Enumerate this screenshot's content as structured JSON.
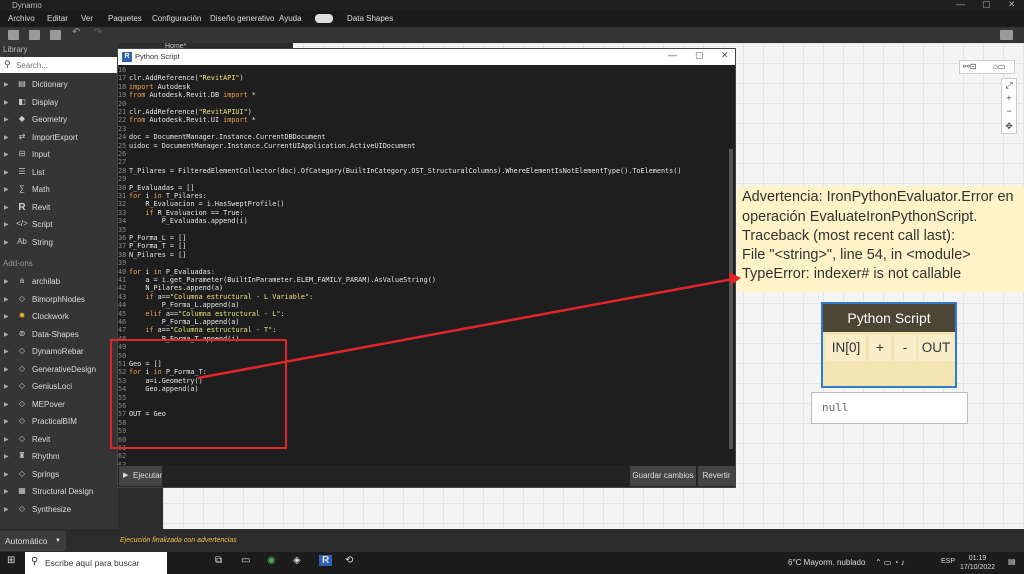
{
  "app": {
    "title": "Dynamo"
  },
  "menu": [
    "Archivo",
    "Editar",
    "Ver",
    "Paquetes",
    "Configuración",
    "Diseño generativo",
    "Ayuda",
    "Data Shapes"
  ],
  "library": {
    "title": "Library",
    "search_placeholder": "Search...",
    "items": [
      "Dictionary",
      "Display",
      "Geometry",
      "ImportExport",
      "Input",
      "List",
      "Math",
      "Revit",
      "Script",
      "String"
    ],
    "addons_label": "Add-ons",
    "addons": [
      "archilab",
      "BimorphNodes",
      "Clockwork",
      "Data-Shapes",
      "DynamoRebar",
      "GenerativeDesign",
      "GeniusLoci",
      "MEPover",
      "PracticalBIM",
      "Revit",
      "Rhythm",
      "Springs",
      "Structural Design",
      "Synthesize"
    ]
  },
  "workspace": {
    "tab": "Home*"
  },
  "editor": {
    "title": "Python Script",
    "run_label": "Ejecutar",
    "save_label": "Guardar cambios",
    "revert_label": "Revertir",
    "lines": [
      [
        "16",
        ""
      ],
      [
        "17",
        "clr.AddReference(\"RevitAPI\")"
      ],
      [
        "18",
        "import Autodesk"
      ],
      [
        "19",
        "from Autodesk.Revit.DB import *"
      ],
      [
        "20",
        ""
      ],
      [
        "21",
        "clr.AddReference(\"RevitAPIUI\")"
      ],
      [
        "22",
        "from Autodesk.Revit.UI import *"
      ],
      [
        "23",
        ""
      ],
      [
        "24",
        "doc = DocumentManager.Instance.CurrentDBDocument"
      ],
      [
        "25",
        "uidoc = DocumentManager.Instance.CurrentUIApplication.ActiveUIDocument"
      ],
      [
        "26",
        ""
      ],
      [
        "27",
        ""
      ],
      [
        "28",
        "T_Pilares = FilteredElementCollector(doc).OfCategory(BuiltInCategory.OST_StructuralColumns).WhereElementIsNotElementType().ToElements()"
      ],
      [
        "29",
        ""
      ],
      [
        "30",
        "P_Evaluadas = []"
      ],
      [
        "31",
        "for i in T_Pilares:"
      ],
      [
        "32",
        "    R_Evaluacion = i.HasSweptProfile()"
      ],
      [
        "33",
        "    if R_Evaluacion == True:"
      ],
      [
        "34",
        "        P_Evaluadas.append(i)"
      ],
      [
        "35",
        ""
      ],
      [
        "36",
        "P_Forma_L = []"
      ],
      [
        "37",
        "P_Forma_T = []"
      ],
      [
        "38",
        "N_Pilares = []"
      ],
      [
        "39",
        ""
      ],
      [
        "40",
        "for i in P_Evaluadas:"
      ],
      [
        "41",
        "    a = i.get_Parameter(BuiltInParameter.ELEM_FAMILY_PARAM).AsValueString()"
      ],
      [
        "42",
        "    N_Pilares.append(a)"
      ],
      [
        "43",
        "    if a==\"Columna estructural - L Variable\":"
      ],
      [
        "44",
        "        P_Forma_L.append(a)"
      ],
      [
        "45",
        "    elif a==\"Columna estructural - L\":"
      ],
      [
        "46",
        "        P_Forma_L.append(a)"
      ],
      [
        "47",
        "    if a==\"Columna estructural - T\":"
      ],
      [
        "48",
        "        P_Forma_T.append(i)"
      ],
      [
        "49",
        ""
      ],
      [
        "50",
        ""
      ],
      [
        "51",
        "Geo = []"
      ],
      [
        "52",
        "for i in P_Forma_T:"
      ],
      [
        "53",
        "    a=i.Geometry()"
      ],
      [
        "54",
        "    Geo.append(a)"
      ],
      [
        "55",
        ""
      ],
      [
        "56",
        ""
      ],
      [
        "57",
        "OUT = Geo"
      ],
      [
        "58",
        ""
      ],
      [
        "59",
        ""
      ],
      [
        "60",
        ""
      ],
      [
        "61",
        ""
      ],
      [
        "62",
        ""
      ],
      [
        "63",
        ""
      ]
    ]
  },
  "warning": {
    "lines": [
      "Advertencia: IronPythonEvaluator.Error en",
      "operación EvaluateIronPythonScript.",
      "Traceback (most recent call last):",
      "  File \"<string>\", line 54, in <module>",
      "TypeError: indexer# is not callable"
    ]
  },
  "node": {
    "title": "Python Script",
    "input_port": "IN[0]",
    "add_port": "+",
    "remove_port": "-",
    "output_port": "OUT",
    "preview_value": "null"
  },
  "status": {
    "run_mode": "Automático",
    "message": "Ejecución finalizada con advertencias"
  },
  "taskbar": {
    "search_placeholder": "Escribe aquí para buscar",
    "weather": "6°C  Mayorm. nublado",
    "language": "ESP",
    "time": "01:19",
    "date": "17/10/2022"
  },
  "colors": {
    "highlight": "#e0262a",
    "node_border": "#2e7bd6",
    "warning_bg": "#fff3c7",
    "status_warning": "#f2c14e"
  }
}
